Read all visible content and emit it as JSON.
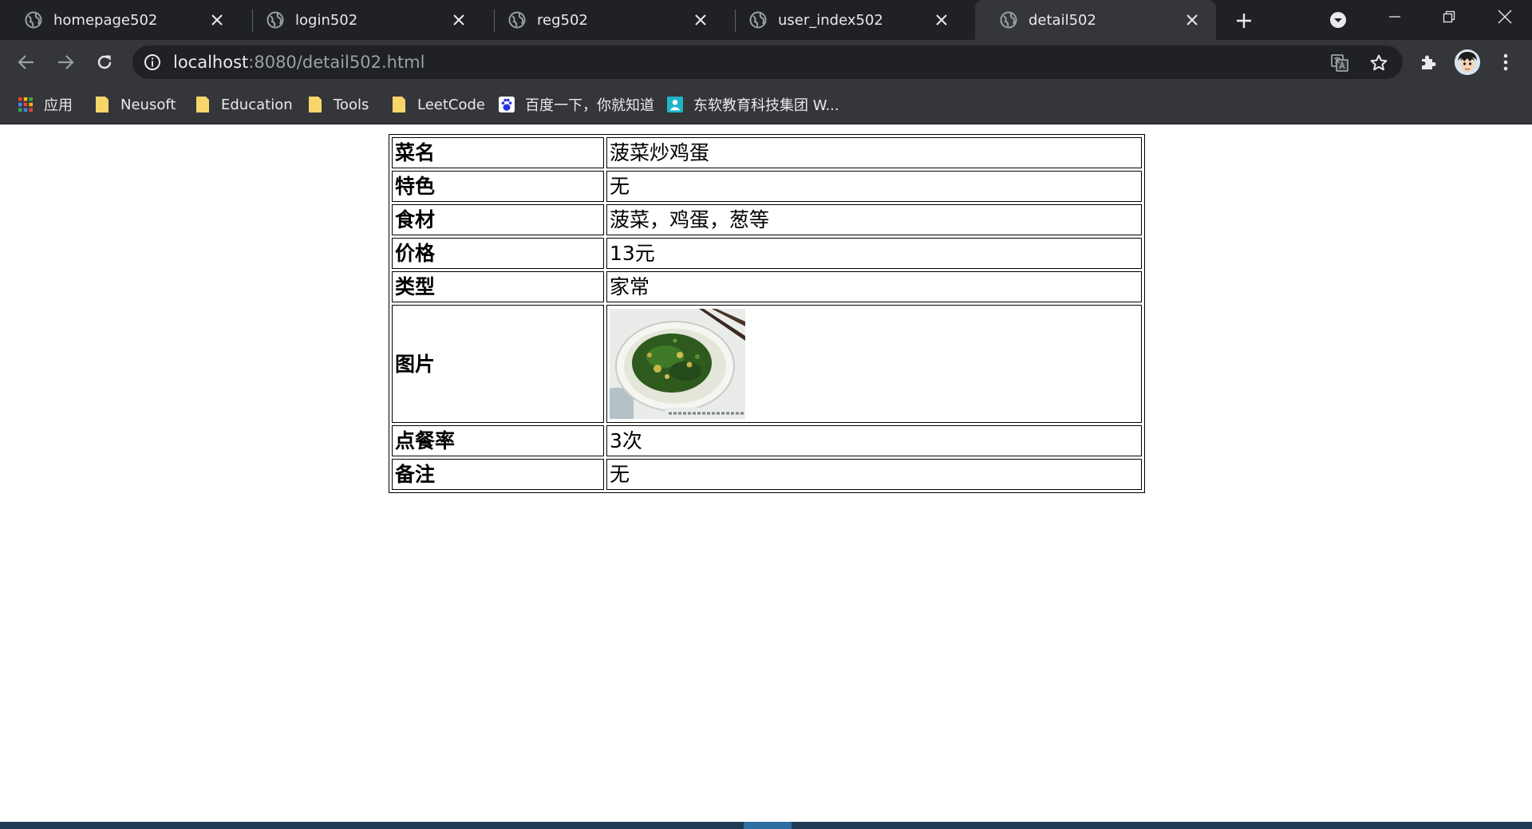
{
  "browser": {
    "tabs": [
      {
        "title": "homepage502",
        "active": false
      },
      {
        "title": "login502",
        "active": false
      },
      {
        "title": "reg502",
        "active": false
      },
      {
        "title": "user_index502",
        "active": false
      },
      {
        "title": "detail502",
        "active": true
      }
    ],
    "address": {
      "host": "localhost",
      "rest": ":8080/detail502.html"
    },
    "bookmarks": [
      {
        "label": "应用",
        "icon": "apps-grid-icon"
      },
      {
        "label": "Neusoft",
        "icon": "folder-icon"
      },
      {
        "label": "Education",
        "icon": "folder-icon"
      },
      {
        "label": "Tools",
        "icon": "folder-icon"
      },
      {
        "label": "LeetCode",
        "icon": "folder-icon"
      },
      {
        "label": "百度一下，你就知道",
        "icon": "baidu-paw-icon"
      },
      {
        "label": "东软教育科技集团 W...",
        "icon": "neusoft-edu-icon"
      }
    ]
  },
  "detail": {
    "rows": [
      {
        "label": "菜名",
        "value": "菠菜炒鸡蛋"
      },
      {
        "label": "特色",
        "value": "无"
      },
      {
        "label": "食材",
        "value": "菠菜，鸡蛋，葱等"
      },
      {
        "label": "价格",
        "value": "13元"
      },
      {
        "label": "类型",
        "value": "家常"
      },
      {
        "label": "图片",
        "value": ""
      },
      {
        "label": "点餐率",
        "value": "3次"
      },
      {
        "label": "备注",
        "value": "无"
      }
    ]
  },
  "colors": {
    "tabstrip": "#202124",
    "toolbar": "#35363a",
    "text_light": "#e8eaed",
    "folder": "#f6d66b"
  }
}
